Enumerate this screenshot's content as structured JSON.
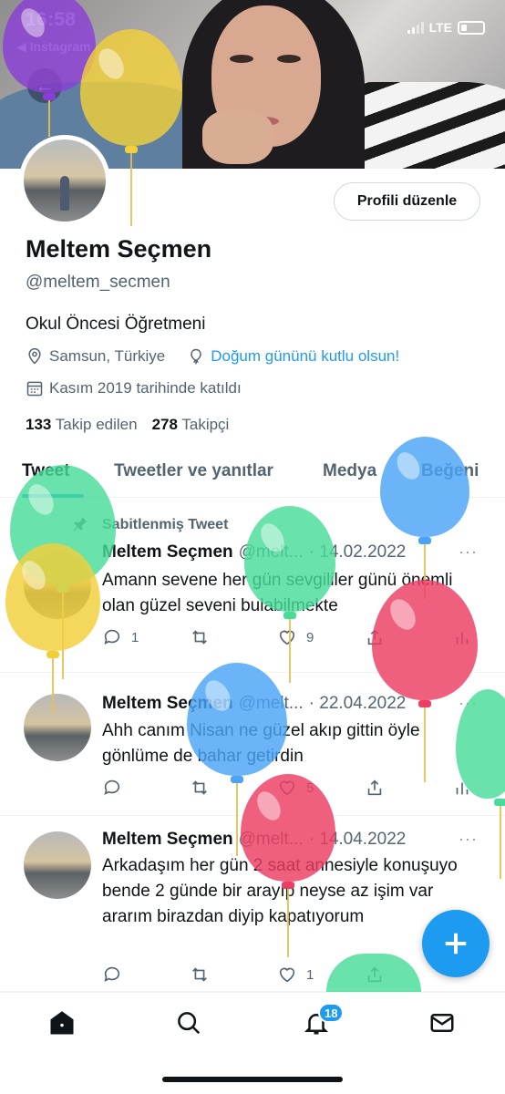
{
  "status_bar": {
    "time": "16:58",
    "back_app": "◀ Instagram",
    "network": "LTE"
  },
  "profile": {
    "edit_label": "Profili düzenle",
    "name": "Meltem Seçmen",
    "handle": "@meltem_secmen",
    "bio": "Okul Öncesi Öğretmeni",
    "location": "Samsun, Türkiye",
    "birthday_text": "Doğum gününü kutlu olsun!",
    "joined": "Kasım 2019 tarihinde katıldı",
    "following_count": "133",
    "following_label": "Takip edilen",
    "followers_count": "278",
    "followers_label": "Takipçi"
  },
  "tabs": [
    {
      "label": "Tweet"
    },
    {
      "label": "Tweetler ve yanıtlar"
    },
    {
      "label": "Medya"
    },
    {
      "label": "Beğeni"
    }
  ],
  "pinned_label": "Sabitlenmiş Tweet",
  "tweets": [
    {
      "name": "Meltem Seçmen",
      "handle": "@melt...",
      "date": "· 14.02.2022",
      "more": "···",
      "text": "Amann sevene her gün sevgililer günü önemli olan güzel seveni bulabilmekte",
      "replies": "1",
      "retweets": "",
      "likes": "9"
    },
    {
      "name": "Meltem Seçmen",
      "handle": "@melt...",
      "date": "· 22.04.2022",
      "more": "···",
      "text": "Ahh canım Nisan ne güzel akıp gittin öyle gönlüme de bahar getirdin",
      "replies": "",
      "retweets": "",
      "likes": "5"
    },
    {
      "name": "Meltem Seçmen",
      "handle": "@melt...",
      "date": "· 14.04.2022",
      "more": "···",
      "text": "Arkadaşım her gün 2 saat annesiyle konuşuyo bende 2 günde bir arayıp neyse az işim var ararım birazdan diyip kapatıyorum",
      "replies": "",
      "retweets": "",
      "likes": "1"
    }
  ],
  "nav": {
    "notification_count": "18"
  },
  "colors": {
    "accent": "#1d9bf0",
    "text": "#0f1419",
    "muted": "#536471"
  },
  "icons": [
    "back-arrow-icon",
    "location-icon",
    "balloon-icon",
    "calendar-icon",
    "pin-icon",
    "reply-icon",
    "retweet-icon",
    "like-icon",
    "share-icon",
    "analytics-icon",
    "compose-plus-icon",
    "home-icon",
    "search-icon",
    "bell-icon",
    "mail-icon"
  ]
}
